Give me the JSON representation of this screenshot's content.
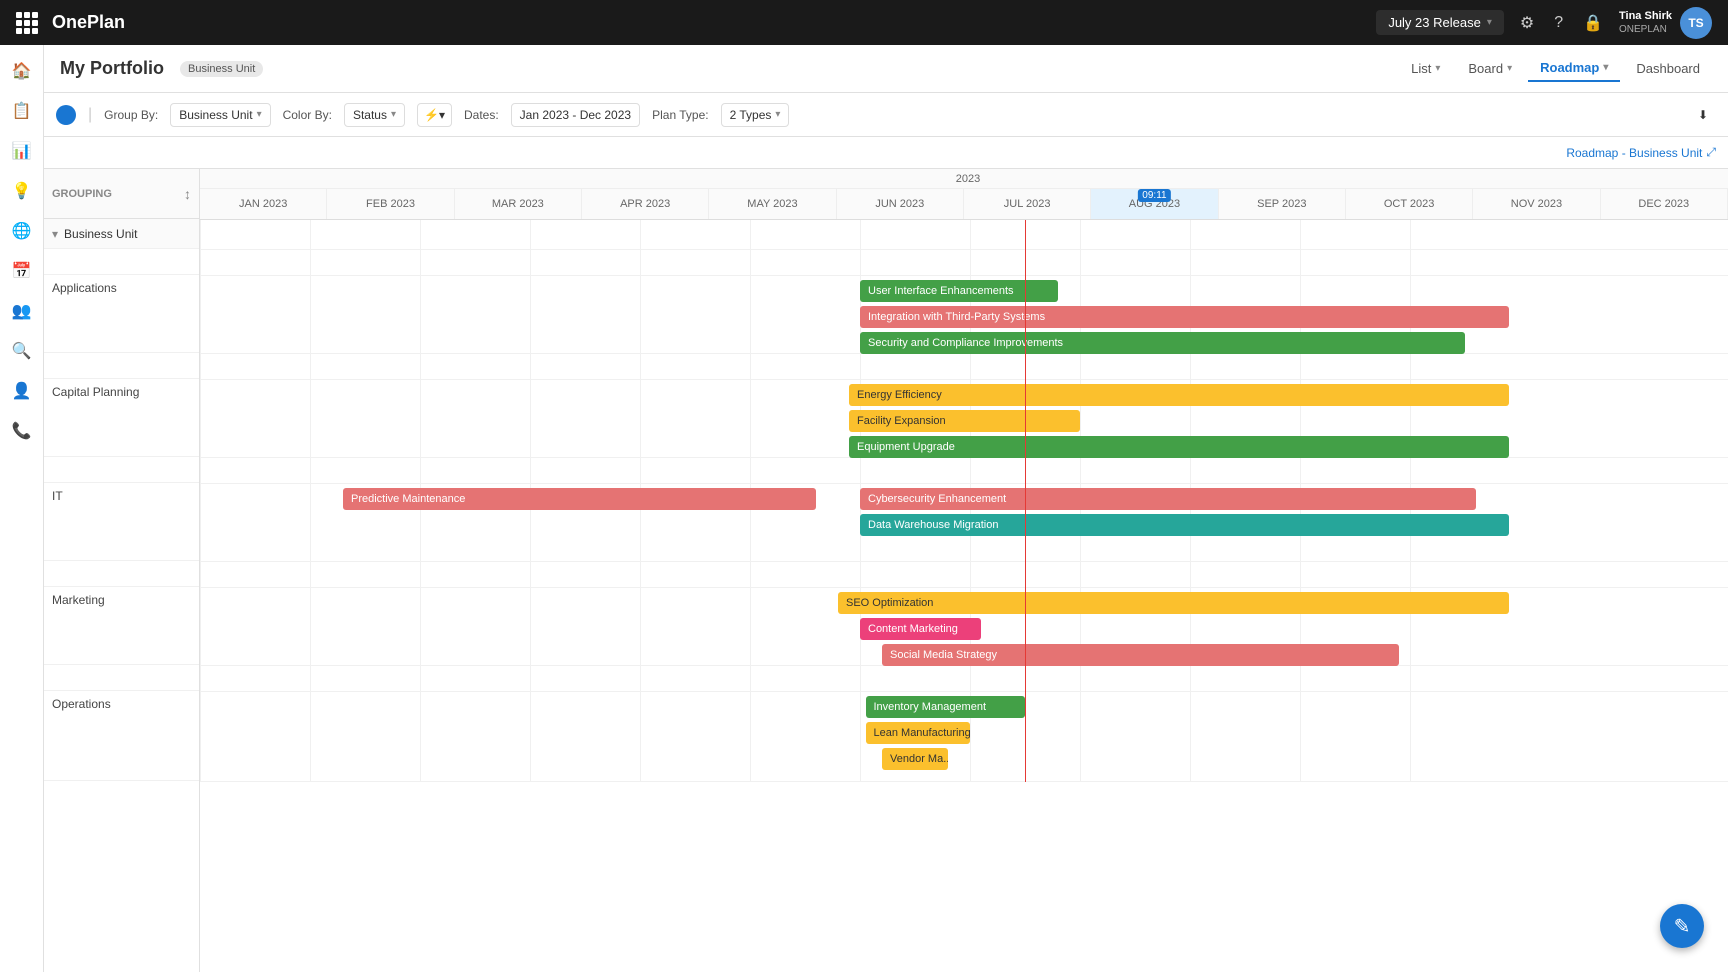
{
  "app": {
    "name": "OnePlan"
  },
  "topbar": {
    "release_label": "July 23 Release",
    "user_name": "Tina Shirk",
    "user_org": "ONEPLAN",
    "user_initials": "TS"
  },
  "header": {
    "title": "My Portfolio",
    "breadcrumb": "Business Unit"
  },
  "views": {
    "list": "List",
    "board": "Board",
    "roadmap": "Roadmap",
    "dashboard": "Dashboard"
  },
  "toolbar": {
    "group_by_label": "Group By:",
    "group_by_value": "Business Unit",
    "color_by_label": "Color By:",
    "color_by_value": "Status",
    "dates_label": "Dates:",
    "dates_value": "Jan 2023 - Dec 2023",
    "plan_type_label": "Plan Type:",
    "plan_type_value": "2 Types"
  },
  "roadmap_title": "Roadmap - Business Unit",
  "gantt": {
    "grouping_header": "GROUPING",
    "year": "2023",
    "today_marker": "09:11",
    "months": [
      "JAN 2023",
      "FEB 2023",
      "MAR 2023",
      "APR 2023",
      "MAY 2023",
      "JUN 2023",
      "JUL 2023",
      "AUG 2023",
      "SEP 2023",
      "OCT 2023",
      "NOV 2023",
      "DEC 2023"
    ],
    "groups": [
      {
        "name": "Business Unit",
        "sub_groups": [
          {
            "name": "Applications",
            "bars": [
              {
                "label": "User Interface Enhancements",
                "color": "bar-green",
                "start_pct": 51.5,
                "width_pct": 18
              },
              {
                "label": "Integration with Third-Party Systems",
                "color": "bar-red",
                "start_pct": 51.5,
                "width_pct": 45
              },
              {
                "label": "Security and Compliance Improvements",
                "color": "bar-green",
                "start_pct": 51.5,
                "width_pct": 42
              }
            ]
          },
          {
            "name": "Capital Planning",
            "bars": [
              {
                "label": "Energy Efficiency",
                "color": "bar-yellow",
                "start_pct": 50,
                "width_pct": 49
              },
              {
                "label": "Facility Expansion",
                "color": "bar-yellow",
                "start_pct": 50,
                "width_pct": 21
              },
              {
                "label": "Equipment Upgrade",
                "color": "bar-green",
                "start_pct": 50,
                "width_pct": 49
              }
            ]
          },
          {
            "name": "IT",
            "bars": [
              {
                "label": "Predictive Maintenance",
                "color": "bar-red",
                "start_pct": 12,
                "width_pct": 30
              },
              {
                "label": "Cybersecurity Enhancement",
                "color": "bar-red",
                "start_pct": 50,
                "width_pct": 48
              },
              {
                "label": "Data Warehouse Migration",
                "color": "bar-teal",
                "start_pct": 50,
                "width_pct": 49
              }
            ]
          },
          {
            "name": "Marketing",
            "bars": [
              {
                "label": "SEO Optimization",
                "color": "bar-yellow",
                "start_pct": 49,
                "width_pct": 50
              },
              {
                "label": "Content Marketing",
                "color": "bar-pink",
                "start_pct": 50,
                "width_pct": 12
              },
              {
                "label": "Social Media Strategy",
                "color": "bar-red",
                "start_pct": 52,
                "width_pct": 35
              }
            ]
          },
          {
            "name": "Operations",
            "bars": [
              {
                "label": "Inventory Management",
                "color": "bar-green",
                "start_pct": 51,
                "width_pct": 14
              },
              {
                "label": "Lean Manufacturing",
                "color": "bar-yellow",
                "start_pct": 51,
                "width_pct": 10
              },
              {
                "label": "Vendor Ma...",
                "color": "bar-yellow",
                "start_pct": 51.5,
                "width_pct": 6
              }
            ]
          }
        ]
      }
    ]
  },
  "fab": {
    "icon": "✎"
  }
}
